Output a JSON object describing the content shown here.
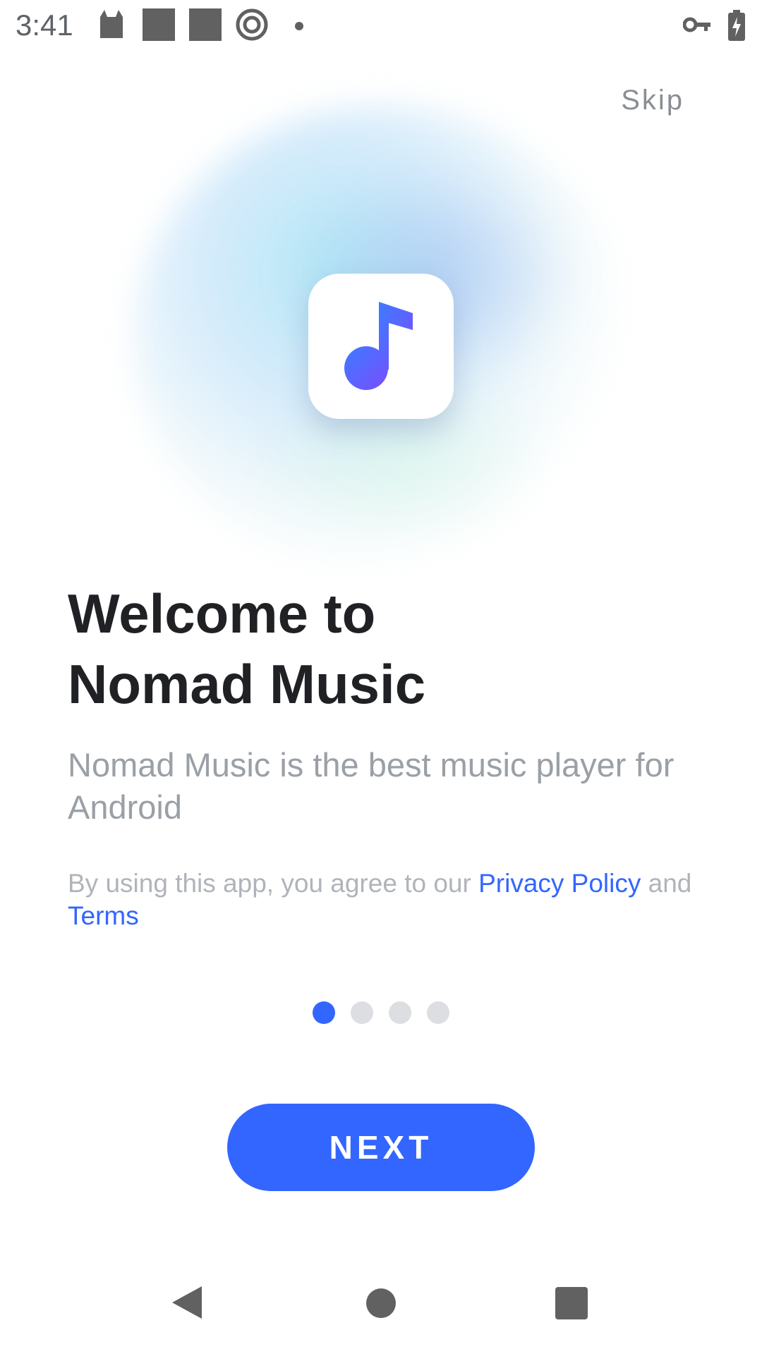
{
  "status_bar": {
    "time": "3:41",
    "left_icons": [
      "cat-icon",
      "square-icon",
      "square-icon",
      "spiral-icon",
      "dot-icon"
    ],
    "right_icons": [
      "vpn-key-icon",
      "battery-charging-icon"
    ]
  },
  "header": {
    "skip_label": "Skip"
  },
  "hero": {
    "app_icon": "music-note-icon"
  },
  "content": {
    "title_line1": "Welcome to",
    "title_line2": "Nomad Music",
    "subtitle": "Nomad Music is the best music player for Android",
    "legal_prefix": "By using this app, you agree to our ",
    "privacy_link": "Privacy Policy",
    "legal_middle": " and ",
    "terms_link": "Terms"
  },
  "pager": {
    "total": 4,
    "current": 1
  },
  "actions": {
    "next_label": "NEXT"
  },
  "colors": {
    "accent": "#3366ff",
    "title": "#202124",
    "muted": "#9aa0a6"
  },
  "nav_bar": {
    "icons": [
      "back-icon",
      "home-icon",
      "recents-icon"
    ]
  }
}
